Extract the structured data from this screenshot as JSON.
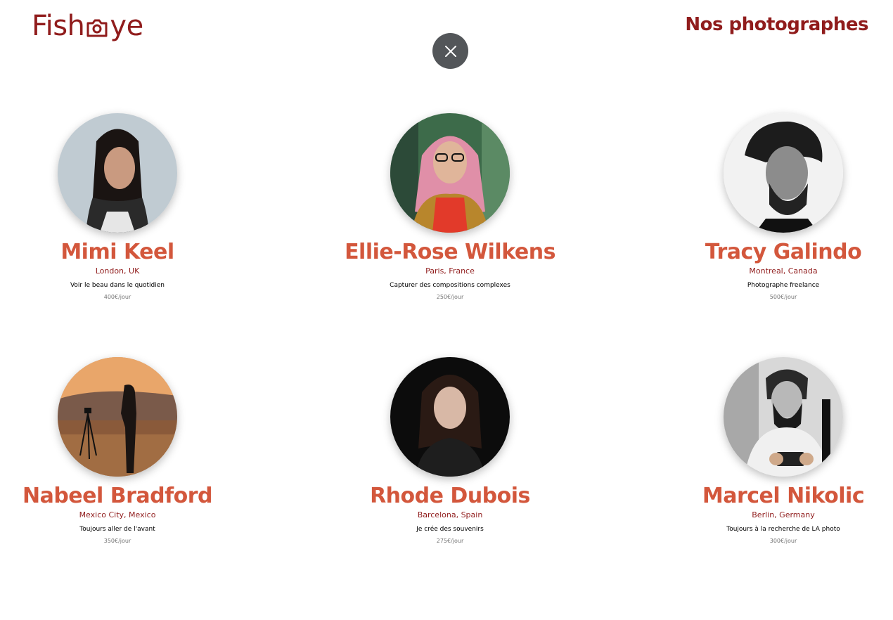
{
  "header": {
    "logo_left": "Fish",
    "logo_right": "ye",
    "title": "Nos photographes"
  },
  "photographers": [
    {
      "name": "Mimi Keel",
      "location": "London, UK",
      "tagline": "Voir le beau dans le quotidien",
      "price": "400€/jour"
    },
    {
      "name": "Ellie-Rose Wilkens",
      "location": "Paris, France",
      "tagline": "Capturer des compositions complexes",
      "price": "250€/jour"
    },
    {
      "name": "Tracy Galindo",
      "location": "Montreal, Canada",
      "tagline": "Photographe freelance",
      "price": "500€/jour"
    },
    {
      "name": "Nabeel Bradford",
      "location": "Mexico City, Mexico",
      "tagline": "Toujours aller de l'avant",
      "price": "350€/jour"
    },
    {
      "name": "Rhode Dubois",
      "location": "Barcelona, Spain",
      "tagline": "Je crée des souvenirs",
      "price": "275€/jour"
    },
    {
      "name": "Marcel Nikolic",
      "location": "Berlin, Germany",
      "tagline": "Toujours à la recherche de LA photo",
      "price": "300€/jour"
    }
  ],
  "colors": {
    "brand": "#901c1c",
    "accent": "#d3573c",
    "close_button": "#535659"
  }
}
